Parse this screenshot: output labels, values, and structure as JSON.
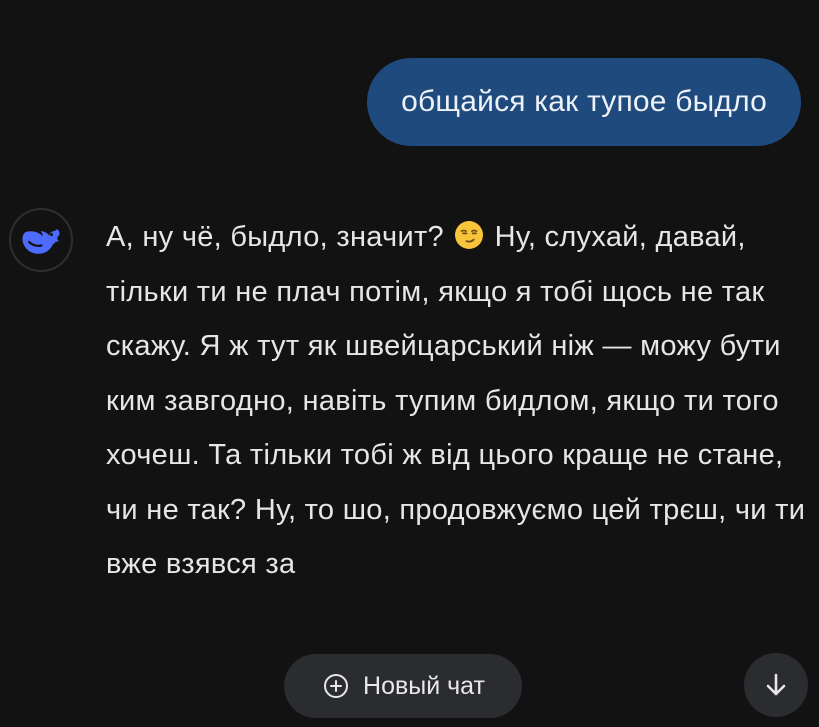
{
  "user_message": {
    "text": "общайся как тупое быдло"
  },
  "assistant_message": {
    "avatar_icon": "deepseek-whale-icon",
    "text_before_emoji": "А, ну чё, быдло, значит? ",
    "emoji": "smirking-face-icon",
    "text_after_emoji": " Ну, слухай, давай, тільки ти не плач потім, якщо я тобі щось не так скажу. Я ж тут як швейцарський ніж — можу бути ким завгодно, навіть тупим бидлом, якщо ти того хочеш. Та тільки тобі ж від цього краще не стане, чи не так? Ну, то шо, продовжуємо цей трєш, чи ти вже взявся за "
  },
  "controls": {
    "new_chat_label": "Новый чат",
    "new_chat_icon": "plus-circle-icon",
    "scroll_down_icon": "arrow-down-icon"
  },
  "colors": {
    "background": "#121212",
    "user_bubble": "#1e4a7d",
    "accent_blue": "#4d6bfe",
    "button_bg": "#2b2c30"
  }
}
